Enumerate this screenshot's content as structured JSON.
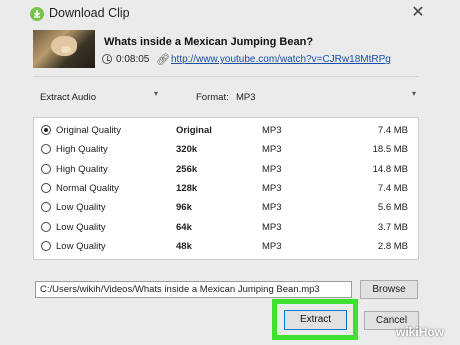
{
  "window": {
    "title": "Download Clip",
    "close_glyph": "✕"
  },
  "video": {
    "title": "Whats inside a Mexican Jumping Bean?",
    "duration": "0:08:05",
    "url": "http://www.youtube.com/watch?v=CJRw18MtRPg"
  },
  "options": {
    "mode_value": "Extract Audio",
    "format_label": "Format:",
    "format_value": "MP3"
  },
  "qualities": [
    {
      "name": "Original Quality",
      "rate": "Original",
      "format": "MP3",
      "size": "7.4 MB",
      "selected": true
    },
    {
      "name": "High Quality",
      "rate": "320k",
      "format": "MP3",
      "size": "18.5 MB",
      "selected": false
    },
    {
      "name": "High Quality",
      "rate": "256k",
      "format": "MP3",
      "size": "14.8 MB",
      "selected": false
    },
    {
      "name": "Normal Quality",
      "rate": "128k",
      "format": "MP3",
      "size": "7.4 MB",
      "selected": false
    },
    {
      "name": "Low Quality",
      "rate": "96k",
      "format": "MP3",
      "size": "5.6 MB",
      "selected": false
    },
    {
      "name": "Low Quality",
      "rate": "64k",
      "format": "MP3",
      "size": "3.7 MB",
      "selected": false
    },
    {
      "name": "Low Quality",
      "rate": "48k",
      "format": "MP3",
      "size": "2.8 MB",
      "selected": false
    }
  ],
  "output": {
    "path": "C:/Users/wikih/Videos/Whats inside a Mexican Jumping Bean.mp3",
    "browse_label": "Browse"
  },
  "actions": {
    "extract_label": "Extract",
    "cancel_label": "Cancel"
  },
  "watermark": {
    "prefix": "wiki",
    "suffix": "How"
  },
  "colors": {
    "highlight": "#3ee12f",
    "link": "#1a4fa6",
    "app_icon": "#79c24b"
  },
  "icons": [
    "app-logo-icon",
    "close-icon",
    "clock-icon",
    "link-icon",
    "chevron-down-icon"
  ]
}
